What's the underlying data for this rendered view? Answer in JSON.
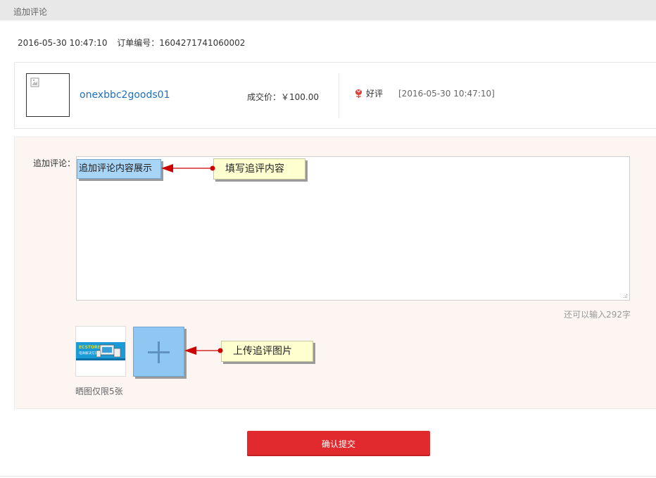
{
  "header": {
    "title": "追加评论"
  },
  "order": {
    "datetime": "2016-05-30 10:47:10",
    "order_no_label": "订单编号：1604271741060002"
  },
  "goods": {
    "name": "onexbbc2goods01",
    "price_label": "成交价：￥100.00",
    "rating": "好评",
    "rating_date": "[2016-05-30 10:47:10]"
  },
  "comment": {
    "label": "追加评论：",
    "counter": "还可以输入292字",
    "upload_limit": "晒图仅限5张"
  },
  "annotations": {
    "content_display": "追加评论内容展示",
    "fill_content": "填写追评内容",
    "upload_images": "上传追评图片"
  },
  "thumbnail_text": {
    "line1": "ECSTORE",
    "line2": "电商解决方案"
  },
  "submit": {
    "label": "确认提交"
  },
  "colors": {
    "link": "#1f6fbf",
    "submit": "#e02a2e",
    "panel_bg": "#fdf5f2",
    "arrow": "#cc0000",
    "callout_yellow": "#ffffd0",
    "callout_blue": "#a8d4f5"
  }
}
